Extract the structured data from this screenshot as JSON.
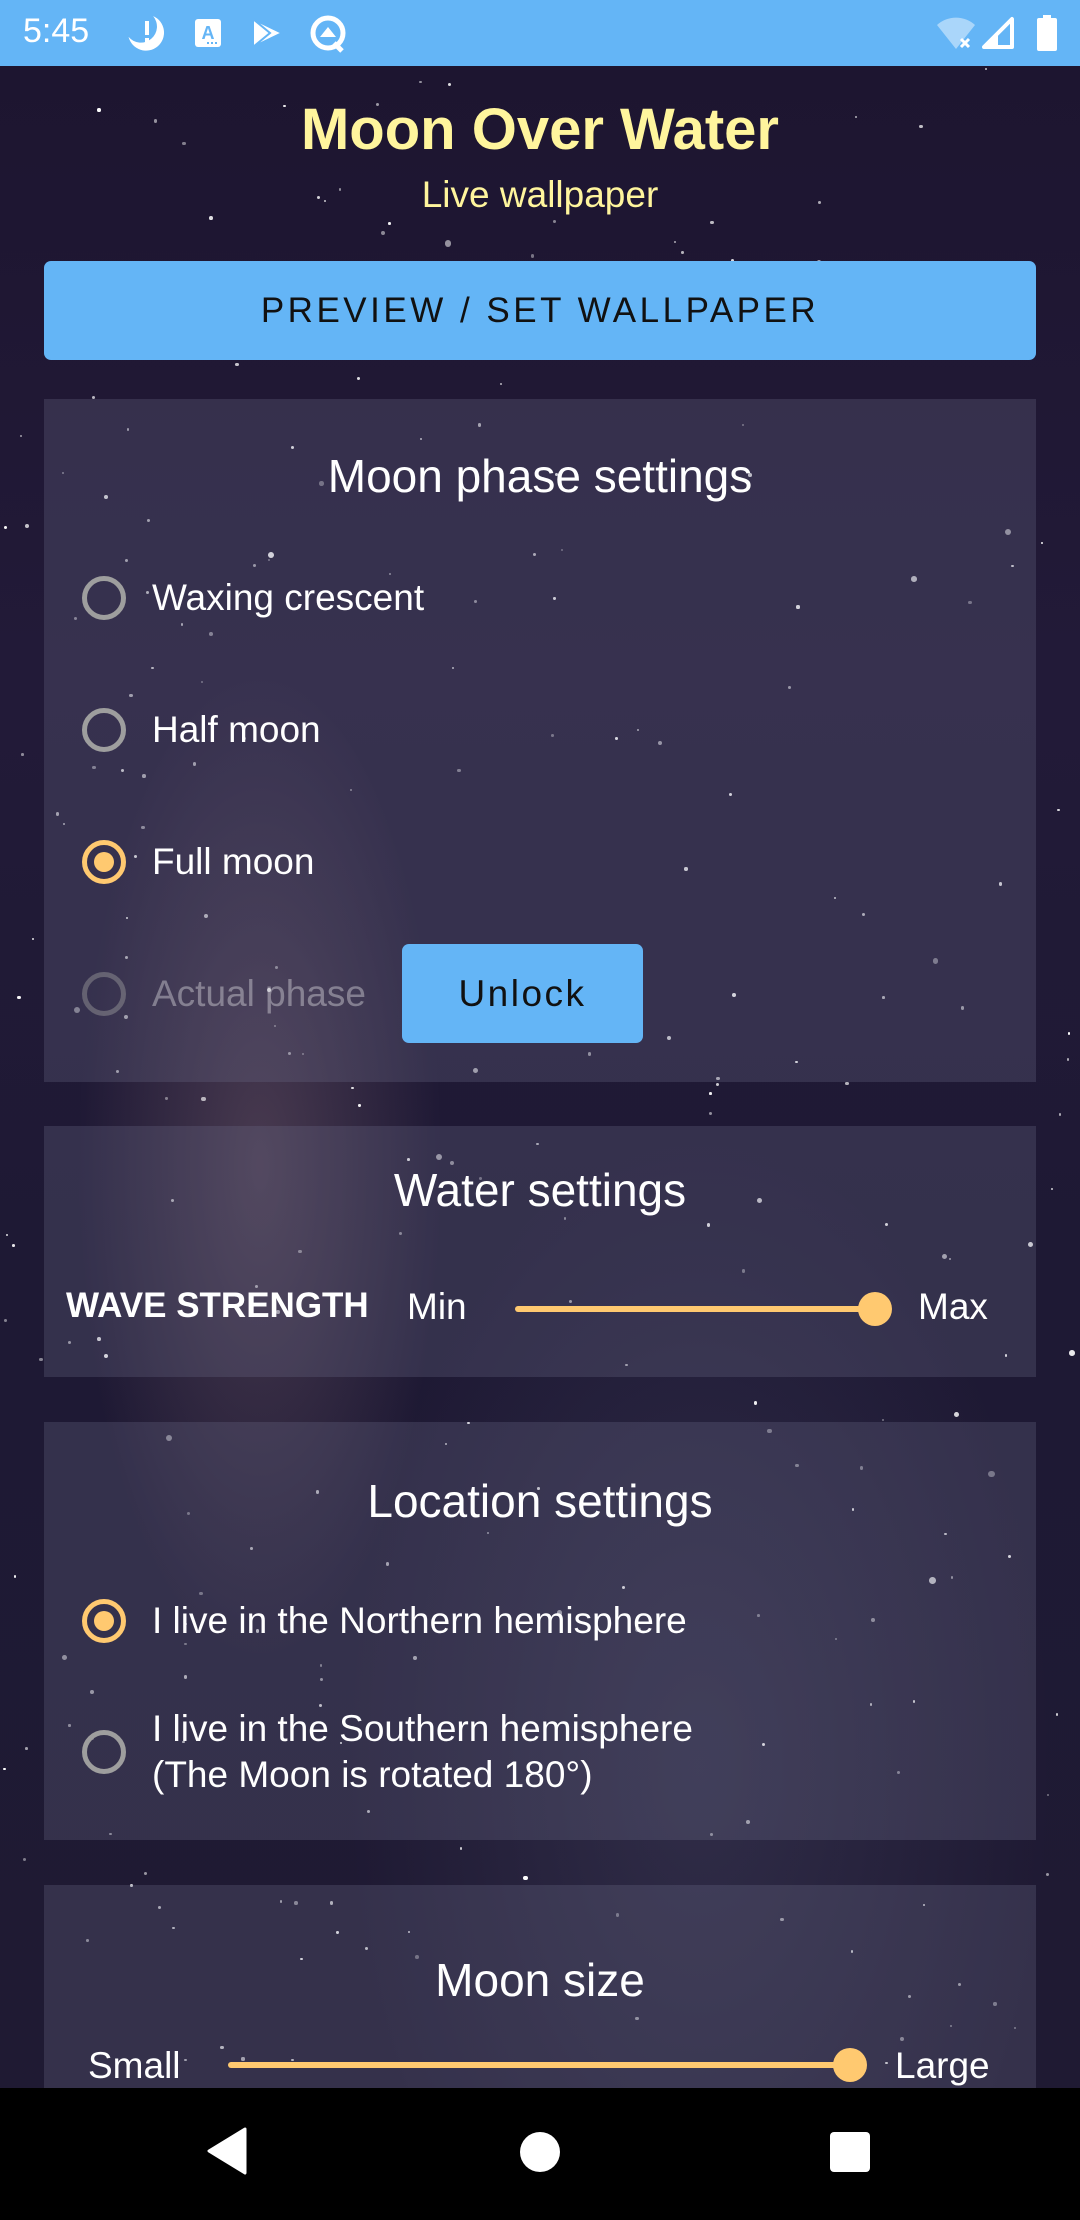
{
  "status_bar": {
    "time": "5:45",
    "left_icons": [
      "do-not-disturb-alert-icon",
      "app-notification-a-icon",
      "play-store-icon",
      "android-q-icon"
    ],
    "right_icons": [
      "wifi-off-icon",
      "cellular-signal-icon",
      "battery-icon"
    ]
  },
  "header": {
    "title": "Moon Over Water",
    "subtitle": "Live wallpaper"
  },
  "preview_button": {
    "label": "PREVIEW / SET WALLPAPER"
  },
  "moon_phase": {
    "title": "Moon phase settings",
    "options": [
      {
        "label": "Waxing crescent",
        "selected": false,
        "enabled": true
      },
      {
        "label": "Half moon",
        "selected": false,
        "enabled": true
      },
      {
        "label": "Full moon",
        "selected": true,
        "enabled": true
      },
      {
        "label": "Actual phase",
        "selected": false,
        "enabled": false
      }
    ],
    "unlock_label": "Unlock"
  },
  "water": {
    "title": "Water settings",
    "wave_strength_label": "WAVE STRENGTH",
    "min_label": "Min",
    "max_label": "Max",
    "wave_strength_value": 1.0
  },
  "location": {
    "title": "Location settings",
    "options": [
      {
        "label": "I live in the Northern hemisphere",
        "selected": true
      },
      {
        "label": "I live in the Southern hemisphere",
        "sublabel": "(The Moon is rotated 180°)",
        "selected": false
      }
    ]
  },
  "moon_size": {
    "title": "Moon size",
    "small_label": "Small",
    "large_label": "Large",
    "value": 1.0
  },
  "colors": {
    "accent_blue": "#64b5f6",
    "title_yellow": "#fff59d",
    "slider_orange": "#ffc970"
  },
  "nav_bar": {
    "buttons": [
      "back",
      "home",
      "recents"
    ]
  }
}
